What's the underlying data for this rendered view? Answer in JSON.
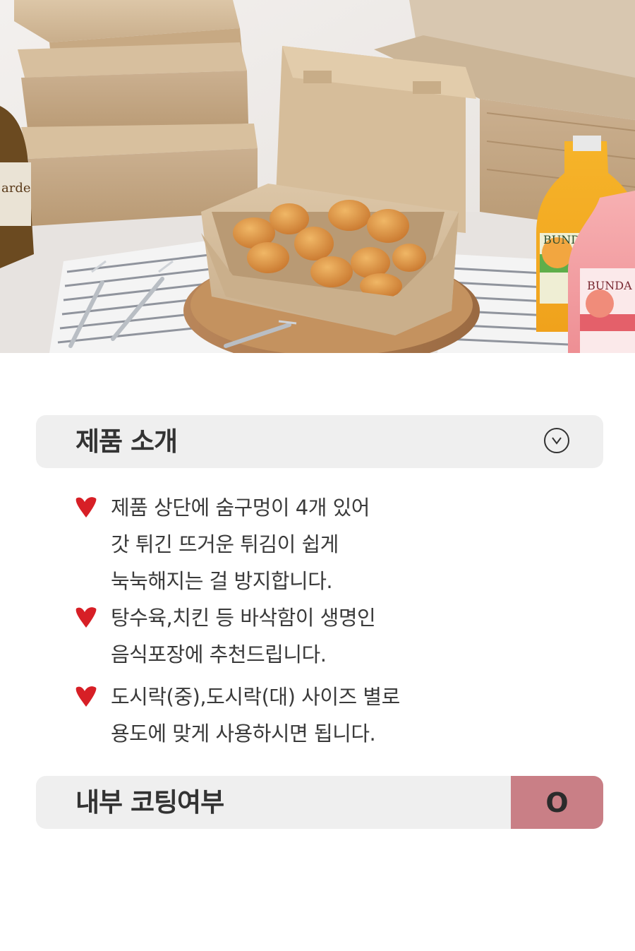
{
  "hero": {
    "image_description_icon": "product-photo-icon"
  },
  "intro": {
    "title": "제품 소개",
    "toggle_icon": "chevron-down-circle-icon"
  },
  "features": [
    {
      "icon": "heart-bullet-icon",
      "lines": [
        "제품 상단에 숨구멍이 4개 있어",
        "갓 튀긴 뜨거운 튀김이 쉽게",
        "눅눅해지는 걸 방지합니다."
      ]
    },
    {
      "icon": "heart-bullet-icon",
      "lines": [
        "탕수육,치킨 등 바삭함이 생명인",
        "음식포장에 추천드립니다."
      ]
    },
    {
      "icon": "heart-bullet-icon",
      "lines": [
        "도시락(중),도시락(대) 사이즈 별로",
        "용도에 맞게 사용하시면 됩니다."
      ]
    }
  ],
  "coating": {
    "label": "내부 코팅여부",
    "value": "O"
  },
  "colors": {
    "bar_bg": "#efefef",
    "heart": "#d71f26",
    "coating_value_bg": "#c97f86"
  }
}
